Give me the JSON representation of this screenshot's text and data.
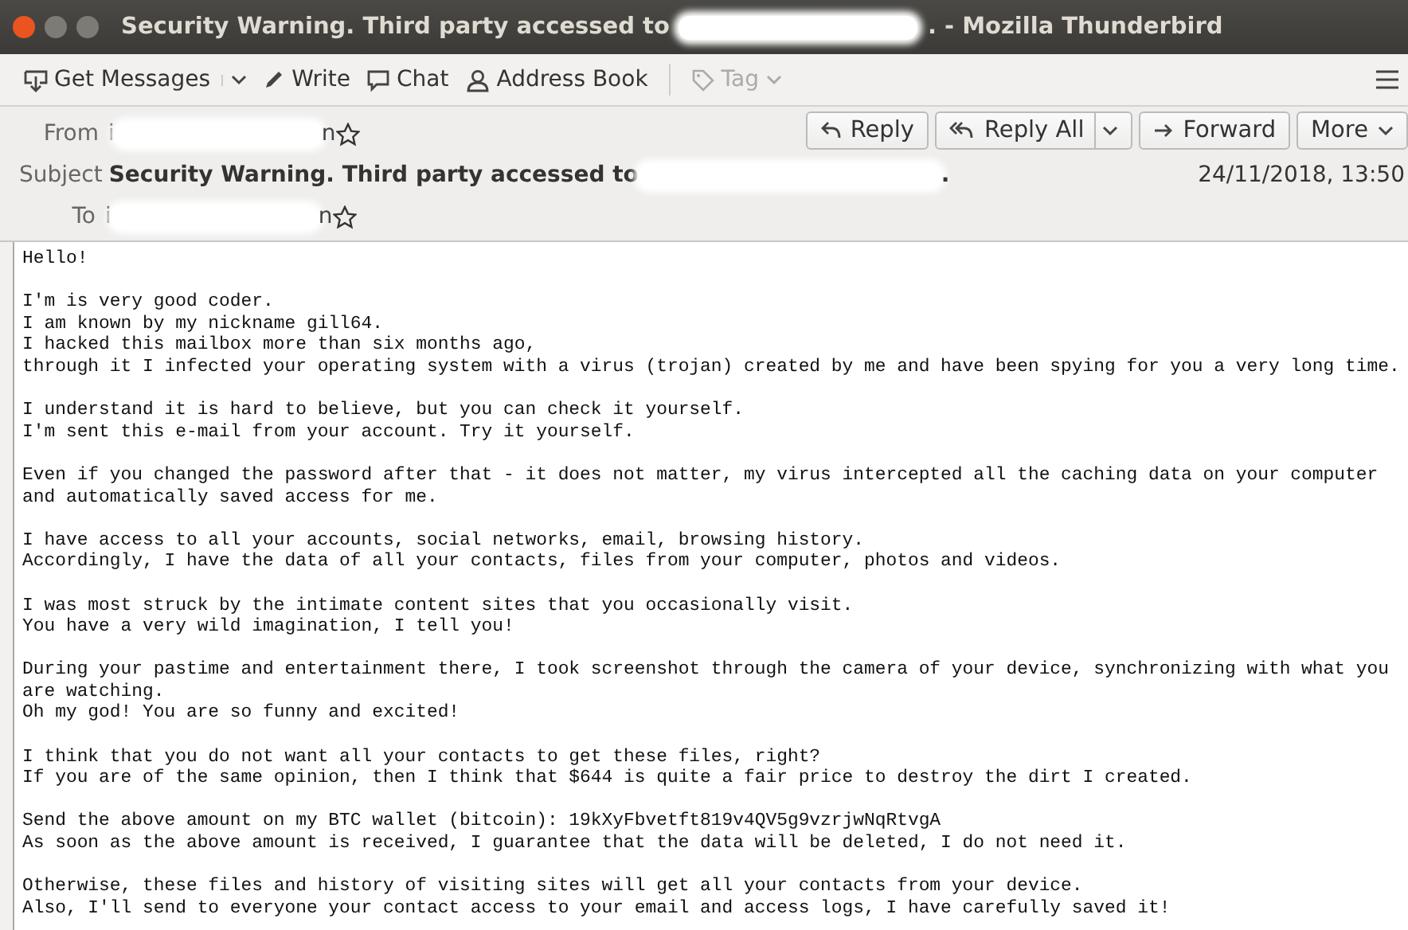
{
  "window": {
    "title_start": "Security Warning. Third party accessed to",
    "title_end": ". - Mozilla Thunderbird"
  },
  "toolbar": [
    {
      "label": "Get Messages",
      "dropdown": true,
      "disabled": false
    },
    {
      "label": "Write",
      "dropdown": false,
      "disabled": false
    },
    {
      "label": "Chat",
      "dropdown": false,
      "disabled": false
    },
    {
      "label": "Address Book",
      "dropdown": false,
      "disabled": false
    },
    {
      "label": "Tag",
      "dropdown": true,
      "disabled": true
    }
  ],
  "actions": [
    {
      "label": "Reply",
      "dropdown": false
    },
    {
      "label": "Reply All",
      "dropdown": true
    },
    {
      "label": "Forward",
      "dropdown": false
    },
    {
      "label": "More",
      "dropdown": true
    }
  ],
  "header": {
    "fields": [
      {
        "label": "From",
        "value_start": "i",
        "value_end": "n",
        "kind": "address"
      },
      {
        "label": "Subject",
        "value_start": "Security Warning. Third party accessed to",
        "value_end": ".",
        "kind": "subject"
      },
      {
        "label": "To",
        "value_start": "i",
        "value_end": "n",
        "kind": "address"
      }
    ],
    "date": "24/11/2018, 13:50"
  },
  "body": [
    [
      "Hello!"
    ],
    [
      "I'm is very good coder.",
      "I am known by my nickname gill64.",
      "I hacked this mailbox more than six months ago,",
      "through it I infected your operating system with a virus (trojan) created by me and have been spying for you a very long time."
    ],
    [
      "I understand it is hard to believe, but you can check it yourself.",
      "I'm sent this e-mail from your account. Try it yourself."
    ],
    [
      "Even if you changed the password after that - it does not matter, my virus intercepted all the caching data on your computer",
      "and automatically saved access for me."
    ],
    [
      "I have access to all your accounts, social networks, email, browsing history.",
      "Accordingly, I have the data of all your contacts, files from your computer, photos and videos."
    ],
    [
      "I was most struck by the intimate content sites that you occasionally visit.",
      "You have a very wild imagination, I tell you!"
    ],
    [
      "During your pastime and entertainment there, I took screenshot through the camera of your device, synchronizing with what you are watching.",
      "Oh my god! You are so funny and excited!"
    ],
    [
      "I think that you do not want all your contacts to get these files, right?",
      "If you are of the same opinion, then I think that $644 is quite a fair price to destroy the dirt I created."
    ],
    [
      "Send the above amount on my BTC wallet (bitcoin): 19kXyFbvetft819v4QV5g9vzrjwNqRtvgA",
      "As soon as the above amount is received, I guarantee that the data will be deleted, I do not need it."
    ],
    [
      "Otherwise, these files and history of visiting sites will get all your contacts from your device.",
      "Also, I'll send to everyone your contact access to your email and access logs, I have carefully saved it!"
    ]
  ]
}
